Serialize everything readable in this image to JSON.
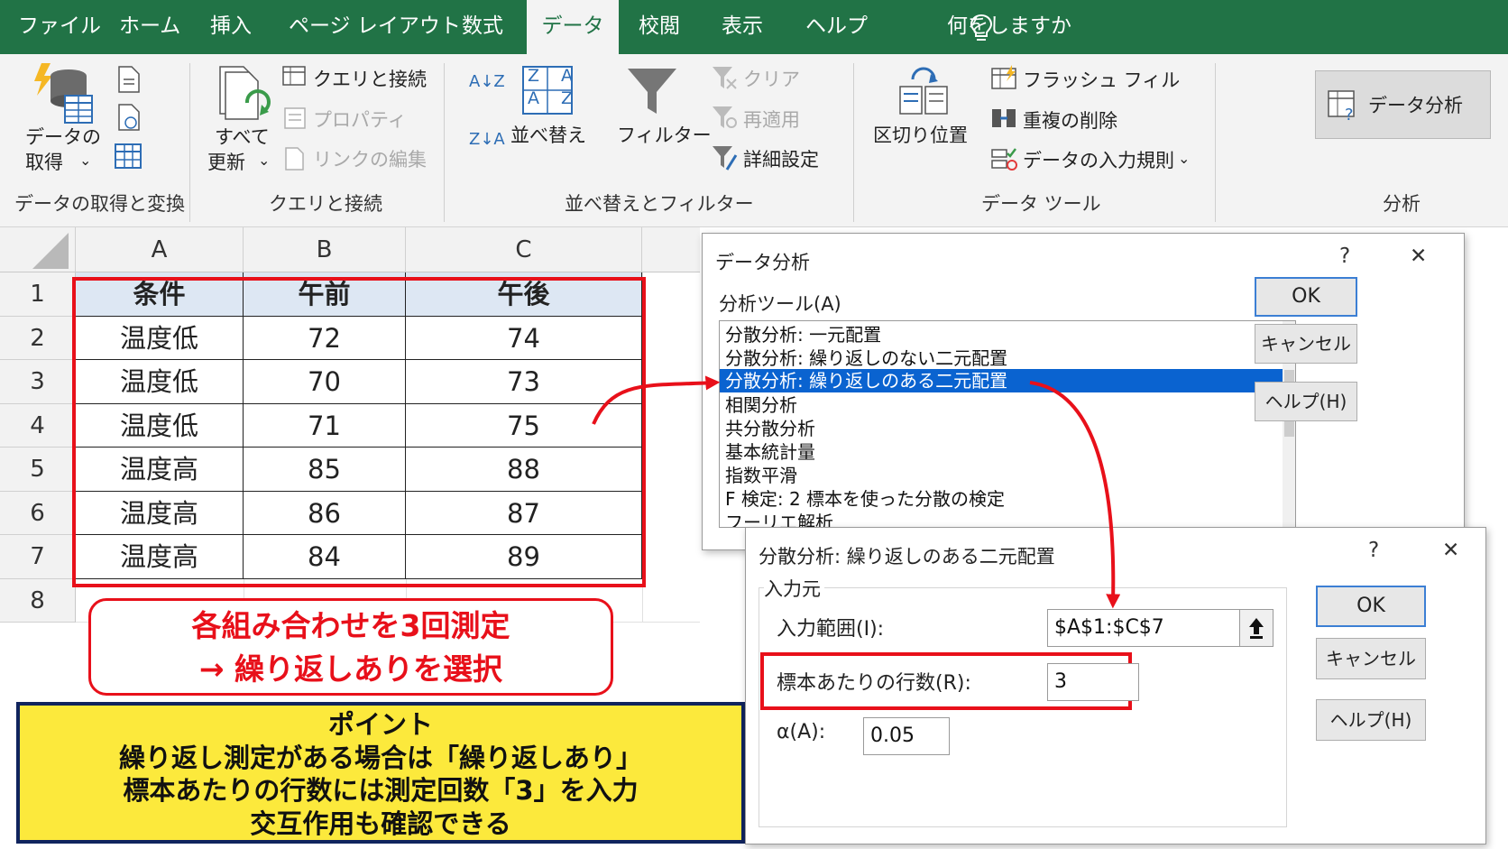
{
  "colors": {
    "excel_green": "#217346",
    "highlight_red": "#e8101a",
    "point_yellow": "#fce93c",
    "selection_blue": "#0a63d0"
  },
  "menu": {
    "tabs": [
      {
        "label": "ファイル"
      },
      {
        "label": "ホーム"
      },
      {
        "label": "挿入"
      },
      {
        "label": "ページ レイアウト"
      },
      {
        "label": "数式"
      },
      {
        "label": "データ"
      },
      {
        "label": "校閲"
      },
      {
        "label": "表示"
      },
      {
        "label": "ヘルプ"
      }
    ],
    "tell_me": "何をしますか",
    "tell_me_icon": "lightbulb-icon"
  },
  "ribbon": {
    "get_data": {
      "label_line1": "データの",
      "label_line2": "取得",
      "group": "データの取得と変換"
    },
    "refresh": {
      "label_line1": "すべて",
      "label_line2": "更新",
      "group": "クエリと接続"
    },
    "queries_connections": "クエリと接続",
    "properties": "プロパティ",
    "edit_links": "リンクの編集",
    "sort": {
      "label": "並べ替え",
      "group": "並べ替えとフィルター"
    },
    "filter": "フィルター",
    "clear": "クリア",
    "reapply": "再適用",
    "advanced": "詳細設定",
    "text_to_columns": {
      "label": "区切り位置",
      "group": "データ ツール"
    },
    "flash_fill": "フラッシュ フィル",
    "remove_duplicates": "重複の削除",
    "data_validation": "データの入力規則",
    "data_analysis": {
      "label": "データ分析",
      "group": "分析"
    },
    "sort_az": "A↓Z",
    "sort_za": "Z↓A",
    "sort_icon_top": "Z A",
    "sort_icon_bottom": "A Z"
  },
  "sheet": {
    "columns": [
      "A",
      "B",
      "C"
    ],
    "rows": [
      "1",
      "2",
      "3",
      "4",
      "5",
      "6",
      "7",
      "8"
    ],
    "header": [
      "条件",
      "午前",
      "午後"
    ],
    "data": [
      [
        "温度低",
        "72",
        "74"
      ],
      [
        "温度低",
        "70",
        "73"
      ],
      [
        "温度低",
        "71",
        "75"
      ],
      [
        "温度高",
        "85",
        "88"
      ],
      [
        "温度高",
        "86",
        "87"
      ],
      [
        "温度高",
        "84",
        "89"
      ]
    ]
  },
  "callout_red": {
    "line1": "各組み合わせを3回測定",
    "line2": "→ 繰り返しありを選択"
  },
  "callout_point": {
    "title": "ポイント",
    "line1": "繰り返し測定がある場合は「繰り返しあり」",
    "line2": "標本あたりの行数には測定回数「3」を入力",
    "line3": "交互作用も確認できる"
  },
  "dialog_analysis": {
    "title": "データ分析",
    "help_symbol": "?",
    "close_symbol": "✕",
    "list_label": "分析ツール(A)",
    "list_items": [
      "分散分析: 一元配置",
      "分散分析: 繰り返しのない二元配置",
      "分散分析: 繰り返しのある二元配置",
      "相関分析",
      "共分散分析",
      "基本統計量",
      "指数平滑",
      "F 検定: 2 標本を使った分散の検定",
      "フーリエ解析"
    ],
    "selected_index": 2,
    "ok": "OK",
    "cancel": "キャンセル",
    "help": "ヘルプ(H)"
  },
  "dialog_anova": {
    "title": "分散分析: 繰り返しのある二元配置",
    "help_symbol": "?",
    "close_symbol": "✕",
    "input_group": "入力元",
    "input_range_label": "入力範囲(I):",
    "input_range_value": "$A$1:$C$7",
    "rows_per_sample_label": "標本あたりの行数(R):",
    "rows_per_sample_value": "3",
    "alpha_label": "α(A):",
    "alpha_value": "0.05",
    "ok": "OK",
    "cancel": "キャンセル",
    "help": "ヘルプ(H)"
  }
}
